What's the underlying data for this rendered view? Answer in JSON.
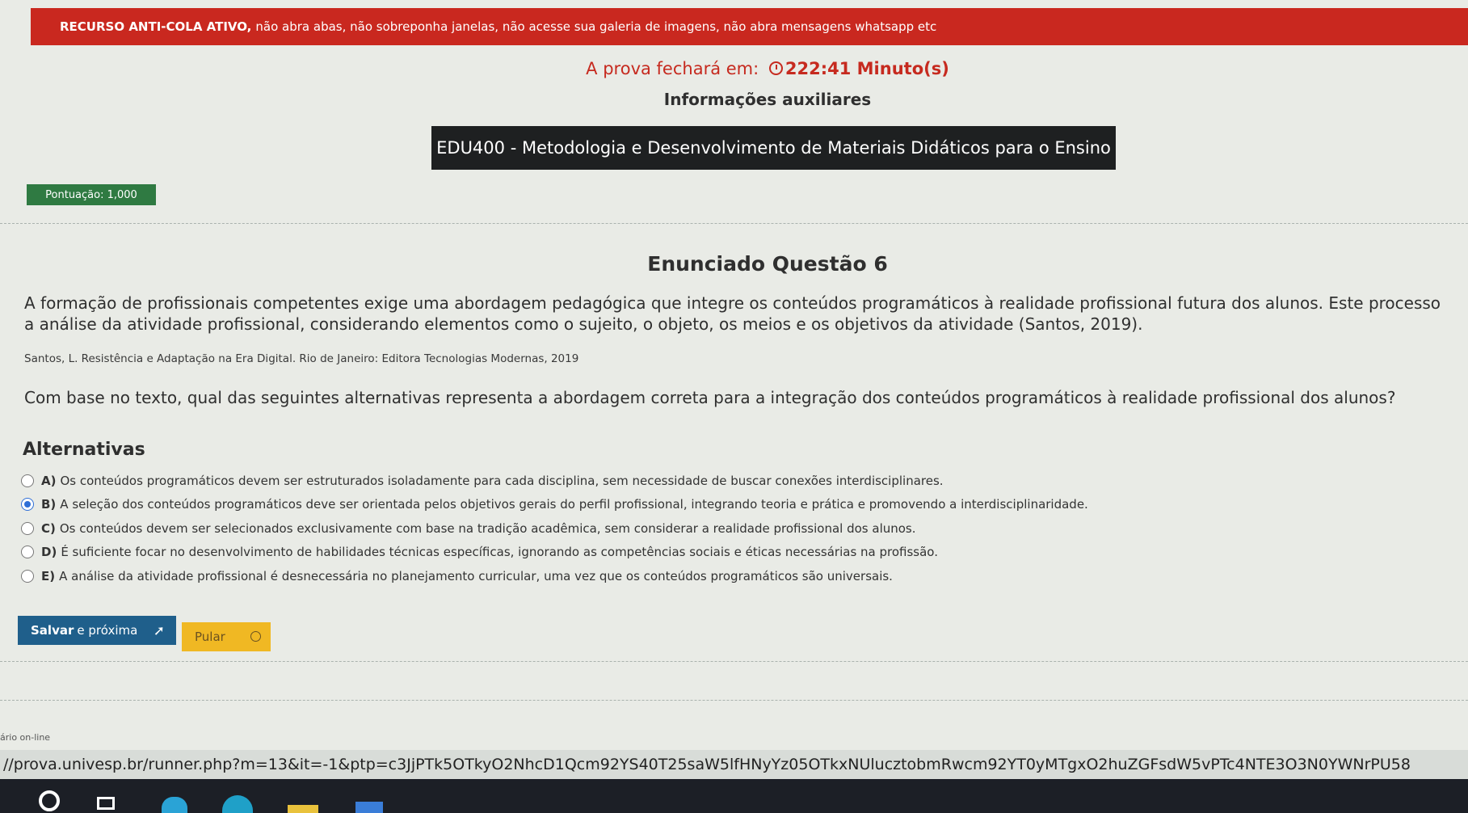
{
  "banner": {
    "bold": "RECURSO ANTI-COLA ATIVO,",
    "text": "não abra abas, não sobreponha janelas, não acesse sua galeria de imagens, não abra mensagens whatsapp etc"
  },
  "timer": {
    "label": "A prova fechará em:",
    "value": "222:41 Minuto(s)"
  },
  "aux_info": "Informações auxiliares",
  "course": "EDU400 - Metodologia e Desenvolvimento de Materiais Didáticos para o Ensino",
  "score": "Pontuação: 1,000",
  "question_title": "Enunciado Questão 6",
  "statement": {
    "line1": "A formação de profissionais competentes exige uma abordagem pedagógica que integre os conteúdos programáticos à realidade profissional futura dos alunos. Este processo",
    "line2": "a análise da atividade profissional, considerando elementos como o sujeito, o objeto, os meios e os objetivos da atividade (Santos, 2019)."
  },
  "citation": "Santos, L. Resistência e Adaptação na Era Digital. Rio de Janeiro: Editora Tecnologias Modernas, 2019",
  "question": "Com base no texto, qual das seguintes alternativas representa a abordagem correta para a integração dos conteúdos programáticos à realidade profissional dos alunos?",
  "alternatives_title": "Alternativas",
  "alternatives": [
    {
      "letter": "A)",
      "text": "Os conteúdos programáticos devem ser estruturados isoladamente para cada disciplina, sem necessidade de buscar conexões interdisciplinares.",
      "selected": false
    },
    {
      "letter": "B)",
      "text": "A seleção dos conteúdos programáticos deve ser orientada pelos objetivos gerais do perfil profissional, integrando teoria e prática e promovendo a interdisciplinaridade.",
      "selected": true
    },
    {
      "letter": "C)",
      "text": "Os conteúdos devem ser selecionados exclusivamente com base na tradição acadêmica, sem considerar a realidade profissional dos alunos.",
      "selected": false
    },
    {
      "letter": "D)",
      "text": "É suficiente focar no desenvolvimento de habilidades técnicas específicas, ignorando as competências sociais e éticas necessárias na profissão.",
      "selected": false
    },
    {
      "letter": "E)",
      "text": "A análise da atividade profissional é desnecessária no planejamento curricular, uma vez que os conteúdos programáticos são universais.",
      "selected": false
    }
  ],
  "buttons": {
    "save_bold": "Salvar",
    "save_rest": "e próxima",
    "skip": "Pular"
  },
  "footer_left": "ário on-line",
  "url": "//prova.univesp.br/runner.php?m=13&it=-1&ptp=c3JjPTk5OTkyO2NhcD1Qcm92YS40T25saW5lfHNyYz05OTkxNUlucztobmRwcm92YT0yMTgxO2huZGFsdW5vPTc4NTE3O3N0YWNrPU58"
}
